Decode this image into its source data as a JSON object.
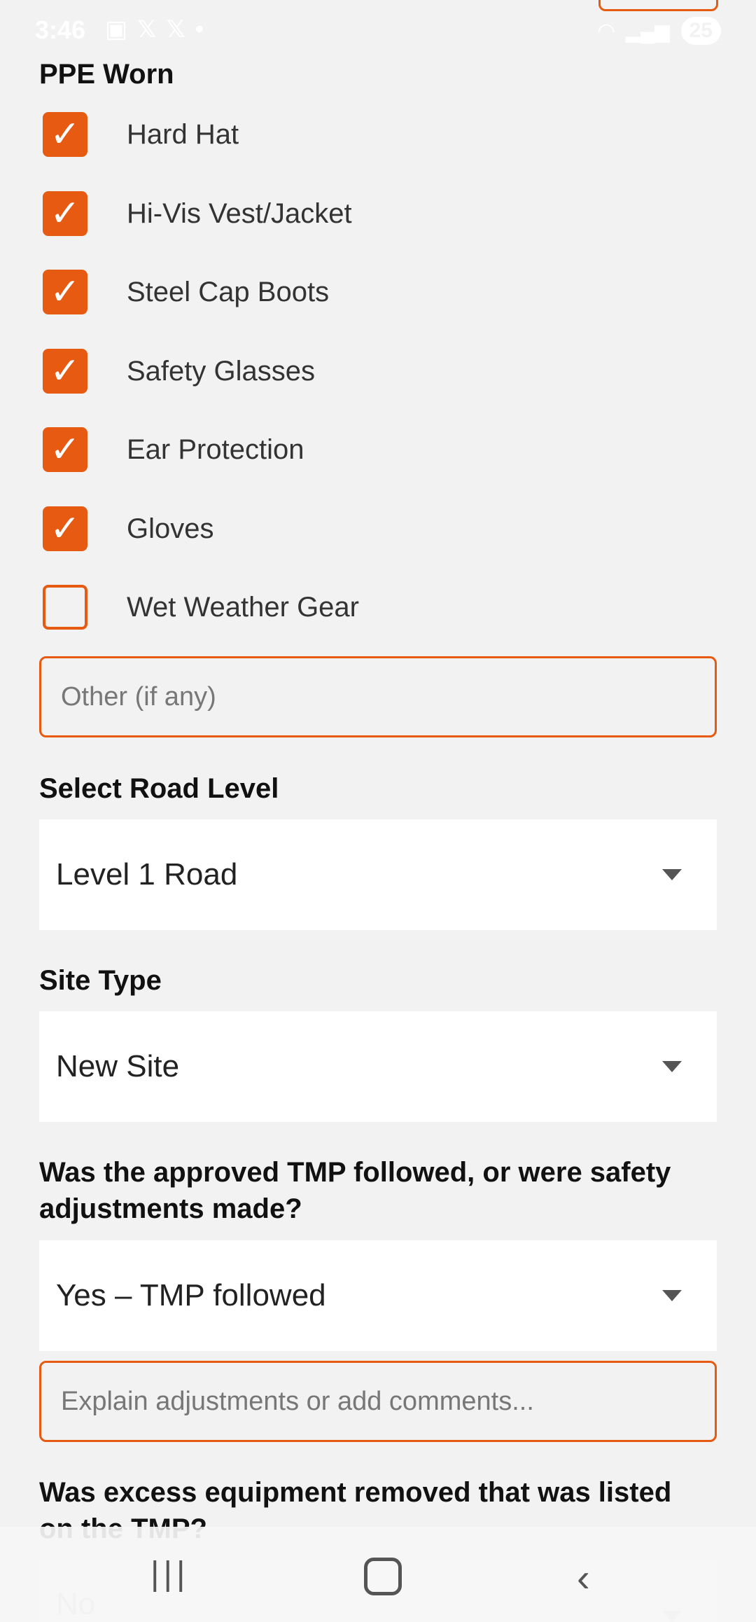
{
  "status_bar": {
    "time": "3:46",
    "icons_left": [
      "screenshot-icon",
      "x-icon",
      "x-icon",
      "dot-icon"
    ],
    "battery": "25"
  },
  "ppe": {
    "title": "PPE Worn",
    "items": [
      {
        "label": "Hard Hat",
        "checked": true
      },
      {
        "label": "Hi-Vis Vest/Jacket",
        "checked": true
      },
      {
        "label": "Steel Cap Boots",
        "checked": true
      },
      {
        "label": "Safety Glasses",
        "checked": true
      },
      {
        "label": "Ear Protection",
        "checked": true
      },
      {
        "label": "Gloves",
        "checked": true
      },
      {
        "label": "Wet Weather Gear",
        "checked": false
      }
    ],
    "other_placeholder": "Other (if any)"
  },
  "road_level": {
    "label": "Select Road Level",
    "value": "Level 1 Road"
  },
  "site_type": {
    "label": "Site Type",
    "value": "New Site"
  },
  "tmp_followed": {
    "label_line1": "Was the approved TMP followed, or were safety",
    "label_line2": "adjustments made?",
    "value": "Yes – TMP followed",
    "comments_placeholder": "Explain adjustments or add comments..."
  },
  "excess_equipment": {
    "label_line1": "Was excess equipment removed that was listed",
    "label_line2": "on the TMP?",
    "value": "No"
  },
  "colors": {
    "accent": "#e65a12",
    "background": "#f2f2f2"
  }
}
